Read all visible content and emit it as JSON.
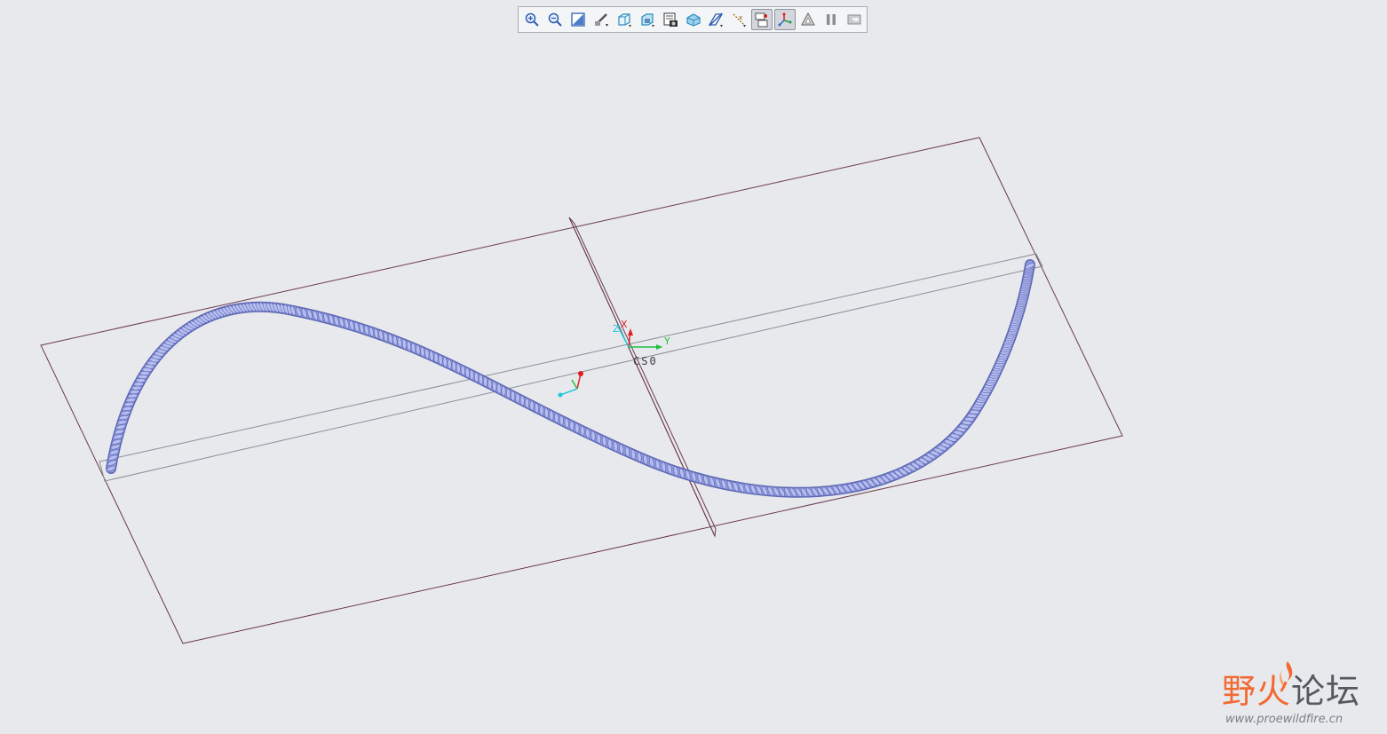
{
  "toolbar": {
    "buttons": [
      {
        "icon": "zoom-in-icon",
        "pressed": false
      },
      {
        "icon": "zoom-out-icon",
        "pressed": false
      },
      {
        "icon": "refit-icon",
        "pressed": false
      },
      {
        "icon": "repaint-icon",
        "pressed": false
      },
      {
        "icon": "display-style-icon",
        "pressed": false
      },
      {
        "icon": "saved-views-icon",
        "pressed": false
      },
      {
        "icon": "view-manager-icon",
        "pressed": false
      },
      {
        "icon": "layers-icon",
        "pressed": false
      },
      {
        "icon": "datum-planes-icon",
        "pressed": false
      },
      {
        "icon": "datum-axes-icon",
        "pressed": false
      },
      {
        "icon": "datum-points-icon",
        "pressed": true
      },
      {
        "icon": "coordinate-systems-icon",
        "pressed": true
      },
      {
        "icon": "annotations-icon",
        "pressed": false
      },
      {
        "icon": "pause-icon",
        "pressed": false
      },
      {
        "icon": "spin-center-icon",
        "pressed": false
      }
    ]
  },
  "csys": {
    "x_label": "X",
    "y_label": "Y",
    "z_label": "Z",
    "name": "CS0"
  },
  "colors": {
    "background": "#e8e9ed",
    "datum_plane": "#6b3a4c",
    "datum_plane_light": "#8a8e96",
    "rope": "#8f99dc",
    "rope_dark": "#5e68b4",
    "x_axis": "#e02020",
    "y_axis": "#20c040",
    "z_axis": "#20c8d8"
  },
  "watermark": {
    "chars_red": "野火",
    "chars_gray": "论坛",
    "url": "www.proewildfire.cn"
  }
}
